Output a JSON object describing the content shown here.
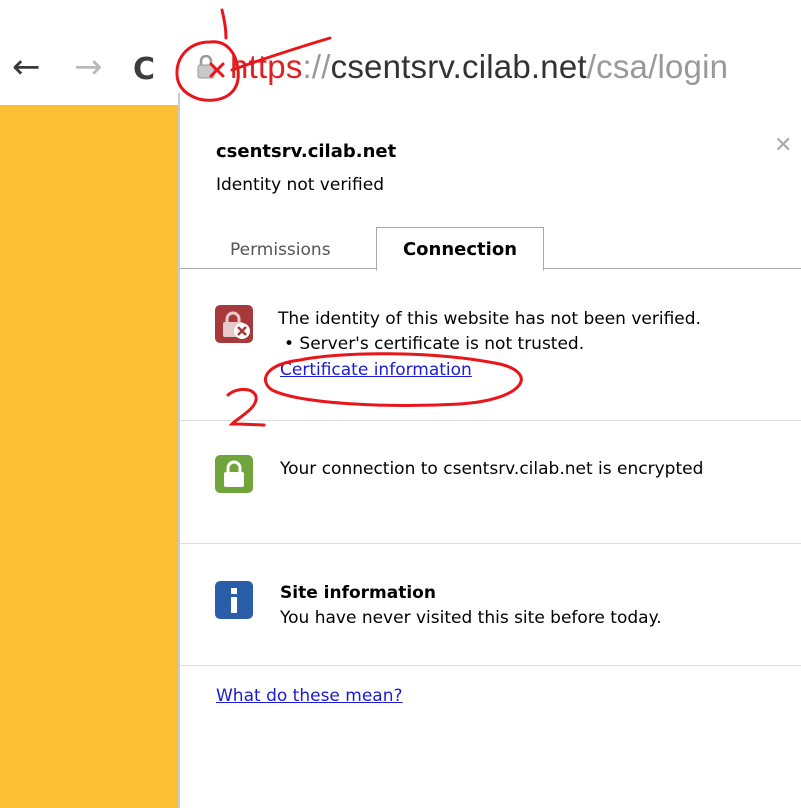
{
  "toolbar": {
    "back_icon": "arrow-left-icon",
    "forward_icon": "arrow-right-icon",
    "reload_icon": "reload-icon",
    "url_scheme": "https",
    "url_sep": "://",
    "url_host": "csentsrv.cilab.net",
    "url_path": "/csa/login"
  },
  "popup": {
    "site_title": "csentsrv.cilab.net",
    "site_subtitle": "Identity not verified",
    "tabs": [
      {
        "label": "Permissions"
      },
      {
        "label": "Connection",
        "active": true
      }
    ],
    "identity": {
      "icon": "lock-error-icon",
      "line1": "The identity of this website has not been verified.",
      "line2": "• Server's certificate is not trusted.",
      "link": "Certificate information"
    },
    "encryption": {
      "icon": "lock-green-icon",
      "text": "Your connection to csentsrv.cilab.net is encrypted"
    },
    "site_info": {
      "icon": "info-icon",
      "title": "Site information",
      "text": "You have never visited this site before today."
    },
    "help_link": "What do these mean?"
  },
  "annotations": {
    "mark1": "1",
    "mark2": "2"
  },
  "colors": {
    "sidebar": "#fbbf34",
    "annotation_red": "#e8161a",
    "error_red": "#a8393a",
    "ok_green": "#6fa53a",
    "info_blue": "#2a5ea8",
    "link_blue": "#1a1ad8"
  }
}
